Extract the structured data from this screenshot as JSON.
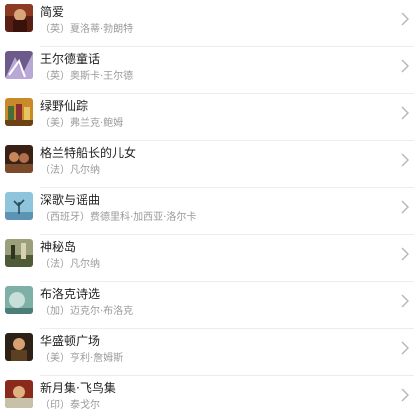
{
  "books": [
    {
      "title": "简爱",
      "author": "（英）夏洛蒂·勃朗特",
      "cover": "cover-jane-eyre"
    },
    {
      "title": "王尔德童话",
      "author": "（英）奥斯卡·王尔德",
      "cover": "cover-wilde-fairy-tales"
    },
    {
      "title": "绿野仙踪",
      "author": "（美）弗兰克·鲍姆",
      "cover": "cover-wizard-of-oz"
    },
    {
      "title": "格兰特船长的儿女",
      "author": "（法）凡尔纳",
      "cover": "cover-captain-grant"
    },
    {
      "title": "深歌与谣曲",
      "author": "（西班牙）费德里科·加西亚·洛尔卡",
      "cover": "cover-deep-song"
    },
    {
      "title": "神秘岛",
      "author": "（法）凡尔纳",
      "cover": "cover-mysterious-island"
    },
    {
      "title": "布洛克诗选",
      "author": "（加）迈克尔·布洛克",
      "cover": "cover-blok-poems"
    },
    {
      "title": "华盛顿广场",
      "author": "（美）亨利·詹姆斯",
      "cover": "cover-washington-square"
    },
    {
      "title": "新月集·飞鸟集",
      "author": "（印）泰戈尔",
      "cover": "cover-crescent-moon"
    }
  ],
  "icons": {
    "chevron": "chevron-right-icon"
  }
}
